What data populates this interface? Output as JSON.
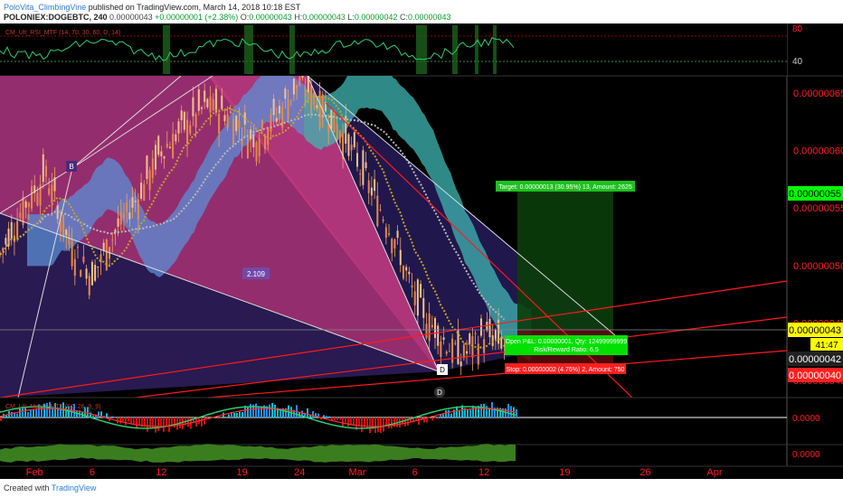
{
  "header": {
    "author": "PoloVita_ClimbingVine",
    "published": "published on TradingView.com, March 14, 2018 10:18 EST",
    "symbol": "POLONIEX:DOGEBTC, 240",
    "last": "0.00000043",
    "change": "+0.00000001 (+2.38%)",
    "o_label": "O:",
    "o": "0.00000043",
    "h_label": "H:",
    "h": "0.00000043",
    "l_label": "L:",
    "l": "0.00000042",
    "c_label": "C:",
    "c": "0.00000043"
  },
  "footer": {
    "created_with": "Created with",
    "brand": "TradingView"
  },
  "indicators": {
    "rsi_label": "CM_Ult_RSI_MTF (14, 70, 30, 60, D, 14)",
    "macd_label": "CM_Ult_MacD_MTF (60, 26, 9, 9)"
  },
  "colors": {
    "up_candle": "#f7a35c",
    "down_candle": "#f7a35c",
    "cloud_blue": "#5b8fd6",
    "cloud_teal": "#3fb7b3",
    "pattern_pink": "#d8377d",
    "pattern_purple": "#4b2a7a",
    "trendline_red": "#ff1a1a",
    "target_green": "#00d000",
    "stop_red": "#ff2020",
    "price_label_yellow": "#ffff00"
  },
  "chart_data": {
    "type": "candlestick",
    "title": "POLONIEX:DOGEBTC, 240",
    "x_tick_labels": [
      "Feb",
      "6",
      "12",
      "19",
      "24",
      "Mar",
      "6",
      "12",
      "19",
      "26",
      "Apr"
    ],
    "y_tick_labels": [
      "0.00000065",
      "0.00000060",
      "0.00000055",
      "0.00000050",
      "0.00000045",
      "0.00000040"
    ],
    "ylim": [
      3.85e-07,
      6.65e-07
    ],
    "price_series": [
      {
        "t": "2018-01-29",
        "close": 5.1e-07
      },
      {
        "t": "2018-01-31",
        "close": 5.5e-07
      },
      {
        "t": "2018-02-02",
        "close": 5.8e-07
      },
      {
        "t": "2018-02-04",
        "close": 5.2e-07
      },
      {
        "t": "2018-02-06",
        "close": 4.9e-07
      },
      {
        "t": "2018-02-08",
        "close": 5.3e-07
      },
      {
        "t": "2018-02-10",
        "close": 5.6e-07
      },
      {
        "t": "2018-02-12",
        "close": 6e-07
      },
      {
        "t": "2018-02-14",
        "close": 6.2e-07
      },
      {
        "t": "2018-02-16",
        "close": 6.4e-07
      },
      {
        "t": "2018-02-18",
        "close": 6.3e-07
      },
      {
        "t": "2018-02-20",
        "close": 6.1e-07
      },
      {
        "t": "2018-02-22",
        "close": 6.3e-07
      },
      {
        "t": "2018-02-24",
        "close": 6.6e-07
      },
      {
        "t": "2018-02-26",
        "close": 6.4e-07
      },
      {
        "t": "2018-02-28",
        "close": 6.1e-07
      },
      {
        "t": "2018-03-02",
        "close": 5.7e-07
      },
      {
        "t": "2018-03-04",
        "close": 5.3e-07
      },
      {
        "t": "2018-03-06",
        "close": 4.7e-07
      },
      {
        "t": "2018-03-08",
        "close": 4.4e-07
      },
      {
        "t": "2018-03-10",
        "close": 4.2e-07
      },
      {
        "t": "2018-03-12",
        "close": 4.4e-07
      },
      {
        "t": "2018-03-14",
        "close": 4.3e-07
      }
    ],
    "pattern_points": [
      {
        "label": "B",
        "date": "2018-02-01",
        "price": 5.8e-07
      },
      {
        "label": "D",
        "date": "2018-03-08",
        "price": 4.2e-07
      },
      {
        "label": "D",
        "date": "2018-03-08",
        "price": 3.95e-07
      }
    ],
    "pattern_ratio_label": "2.109",
    "position": {
      "target_label": "Target: 0.00000013 (30.95%) 13, Amount: 2625",
      "open_label": "Open P&L: 0.00000001, Qty: 12499999999",
      "risk_label": "Risk/Reward Ratio: 6.5",
      "stop_label": "Stop: 0.00000002 (4.76%) 2, Amount: 750",
      "entry": 4.2e-07,
      "target": 5.5e-07,
      "stop": 4e-07
    },
    "price_labels": {
      "target_level": "0.00000055",
      "last": "0.00000043",
      "countdown": "41:47",
      "low": "0.00000042",
      "stop_level": "0.00000040"
    },
    "rsi_axis": [
      "80",
      "40"
    ],
    "macd_axis": [
      "0.0000",
      "0.0000"
    ]
  }
}
